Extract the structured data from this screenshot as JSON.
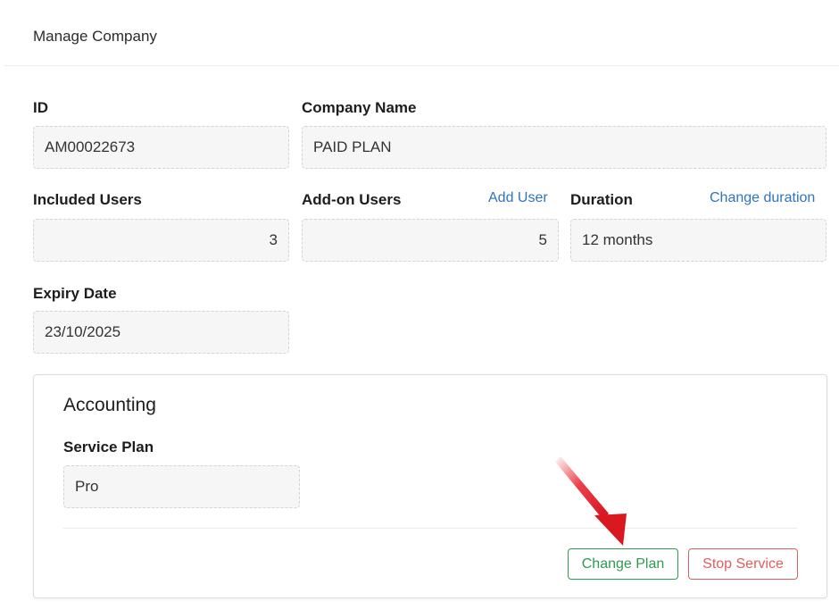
{
  "header": {
    "title": "Manage Company"
  },
  "company": {
    "id_label": "ID",
    "id_value": "AM00022673",
    "name_label": "Company Name",
    "name_value": "PAID PLAN",
    "included_users_label": "Included Users",
    "included_users_value": "3",
    "addon_users_label": "Add-on Users",
    "addon_users_value": "5",
    "add_user_link": "Add User",
    "duration_label": "Duration",
    "duration_value": "12 months",
    "change_duration_link": "Change duration",
    "expiry_label": "Expiry Date",
    "expiry_value": "23/10/2025"
  },
  "service": {
    "title": "Accounting",
    "plan_label": "Service Plan",
    "plan_value": "Pro",
    "change_plan_button": "Change Plan",
    "stop_service_button": "Stop Service"
  },
  "colors": {
    "link": "#2f74c0",
    "success": "#2e9b4f",
    "danger": "#e35d5d",
    "annotation_arrow": "#e8202a"
  },
  "annotation": {
    "icon": "red-arrow-pointer-icon"
  }
}
